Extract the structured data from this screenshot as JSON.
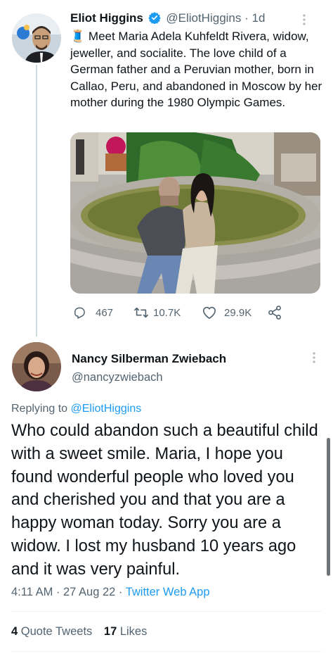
{
  "tweet": {
    "author_name": "Eliot Higgins",
    "author_handle": "@EliotHiggins",
    "age": "· 1d",
    "text_emoji": "🧵",
    "text": "Meet Maria Adela Kuhfeldt Rivera, widow, jeweller, and socialite. The love child of a German father and a Peruvian mother, born in Callao, Peru, and abandoned in Moscow by her mother during the 1980 Olympic Games.",
    "replies": "467",
    "retweets": "10.7K",
    "likes": "29.9K"
  },
  "reply": {
    "author_name": "Nancy Silberman Zwiebach",
    "author_handle": "@nancyzwiebach",
    "replying_prefix": "Replying to",
    "replying_to": "@EliotHiggins",
    "text": "Who could abandon such a beautiful child with a sweet smile. Maria, I hope you found wonderful people who loved you and cherished you and that you are a happy woman today. Sorry you are a widow. I lost my husband 10 years ago and it was very painful.",
    "time": "4:11 AM",
    "date": "· 27 Aug 22 ·",
    "source": "Twitter Web App",
    "quote_count": "4",
    "quote_label": "Quote Tweets",
    "like_count": "17",
    "like_label": "Likes"
  },
  "icons": {
    "verified": "verified-badge-icon",
    "reply": "reply-icon",
    "retweet": "retweet-icon",
    "like": "heart-icon",
    "share": "share-icon",
    "more": "more-dots-icon"
  },
  "colors": {
    "accent": "#1d9bf0",
    "muted": "#536471",
    "text": "#0f1419"
  }
}
